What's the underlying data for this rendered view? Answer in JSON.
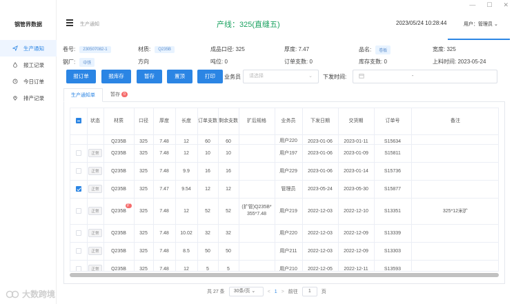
{
  "window": {
    "minimize": "—",
    "maximize": "☐",
    "close": "✕"
  },
  "sidebar": {
    "brand": "钢管界数据",
    "items": [
      {
        "label": "生产通知",
        "icon": "paper-plane-icon",
        "active": true
      },
      {
        "label": "报工记录",
        "icon": "drop-icon",
        "active": false
      },
      {
        "label": "今日订单",
        "icon": "clock-icon",
        "active": false
      },
      {
        "label": "排产记录",
        "icon": "location-icon",
        "active": false
      }
    ]
  },
  "header": {
    "breadcrumb": "生产通知",
    "line_title": "产线：325(直缝五)",
    "datetime": "2023/05/24 10:28:44",
    "user": "用户：管理员"
  },
  "info": {
    "roll_no_label": "卷号:",
    "roll_no": "230507082-1",
    "material_label": "材质:",
    "material": "Q235B",
    "finished_dia_label": "成品口径:",
    "finished_dia": "325",
    "thickness_label": "厚度:",
    "thickness": "7.47",
    "product_name_label": "品名:",
    "product_name": "卷板",
    "width_label": "宽度:",
    "width": "325",
    "steel_mill_label": "钢厂:",
    "steel_mill": "中铁",
    "direction_label": "方向",
    "tonnage_label": "吨位:",
    "tonnage": "0",
    "order_count_label": "订单支数:",
    "order_count": "0",
    "stock_count_label": "库存支数:",
    "stock_count": "0",
    "online_time_label": "上料时间:",
    "online_time": "2023-05-24"
  },
  "toolbar": {
    "report_order": "报订单",
    "report_stock": "报库存",
    "hold": "暂存",
    "pin_top": "置顶",
    "print": "打印",
    "salesman_label": "业务员",
    "salesman_placeholder": "请选择",
    "issue_time_label": "下发时间:",
    "date_separator": "-"
  },
  "tabs": {
    "notice": "生产通知单",
    "hold": "暂存",
    "hold_count": "0"
  },
  "table": {
    "headers": [
      "状态",
      "材质",
      "口径",
      "厚度",
      "长度",
      "订单支数",
      "剩余支数",
      "扩后规格",
      "业务员",
      "下发日期",
      "交货期",
      "订单号",
      "备注"
    ],
    "cut_row": [
      "",
      "Q235B",
      "325",
      "7.48",
      "12",
      "60",
      "60",
      "",
      "用户220",
      "2023-01-06",
      "2023-01-11",
      "S15634",
      ""
    ],
    "rows": [
      {
        "checked": false,
        "status": "正常",
        "material": "Q235B",
        "dia": "325",
        "thick": "7.48",
        "length": "12",
        "order_qty": "10",
        "remain": "10",
        "expanded": "",
        "salesman": "用户197",
        "issue_date": "2023-01-06",
        "delivery": "2023-01-09",
        "order_no": "S15811",
        "note": ""
      },
      {
        "checked": false,
        "status": "正常",
        "material": "Q235B",
        "dia": "325",
        "thick": "7.48",
        "length": "9.9",
        "order_qty": "16",
        "remain": "16",
        "expanded": "",
        "salesman": "用户229",
        "issue_date": "2023-01-06",
        "delivery": "2023-01-14",
        "order_no": "S15736",
        "note": ""
      },
      {
        "checked": true,
        "status": "正常",
        "material": "Q235B",
        "dia": "325",
        "thick": "7.47",
        "length": "9.54",
        "order_qty": "12",
        "remain": "12",
        "expanded": "",
        "salesman": "管理员",
        "issue_date": "2023-05-24",
        "delivery": "2023-05-30",
        "order_no": "S15877",
        "note": ""
      },
      {
        "checked": false,
        "status": "正常",
        "material": "Q235B",
        "mat_badge": "扩",
        "dia": "325",
        "thick": "7.48",
        "length": "12",
        "order_qty": "52",
        "remain": "52",
        "expanded": "(扩管)Q235B*355*7.48",
        "salesman": "用户219",
        "issue_date": "2022-12-03",
        "delivery": "2022-12-10",
        "order_no": "S13351",
        "note": "325*12米扩"
      },
      {
        "checked": false,
        "status": "正常",
        "material": "Q235B",
        "dia": "325",
        "thick": "7.48",
        "length": "10.02",
        "order_qty": "32",
        "remain": "32",
        "expanded": "",
        "salesman": "用户220",
        "issue_date": "2022-12-03",
        "delivery": "2022-12-09",
        "order_no": "S13339",
        "note": ""
      },
      {
        "checked": false,
        "status": "正常",
        "material": "Q235B",
        "dia": "325",
        "thick": "7.48",
        "length": "8.5",
        "order_qty": "50",
        "remain": "50",
        "expanded": "",
        "salesman": "用户211",
        "issue_date": "2022-12-03",
        "delivery": "2022-12-09",
        "order_no": "S13303",
        "note": ""
      },
      {
        "checked": false,
        "status": "正常",
        "material": "Q235B",
        "dia": "325",
        "thick": "7.48",
        "length": "12",
        "order_qty": "5",
        "remain": "5",
        "expanded": "",
        "salesman": "用户210",
        "issue_date": "2022-12-05",
        "delivery": "2022-12-11",
        "order_no": "S13593",
        "note": ""
      }
    ]
  },
  "pager": {
    "total": "共 27 条",
    "page_size": "30条/页",
    "prev": "<",
    "current": "1",
    "next": ">",
    "goto_label": "前往",
    "goto_value": "1",
    "page_unit": "页"
  },
  "watermark": {
    "text": "大数跨境"
  },
  "colors": {
    "primary": "#2b85e4",
    "line_title": "#19a15f",
    "badge": "#f56c6c"
  }
}
